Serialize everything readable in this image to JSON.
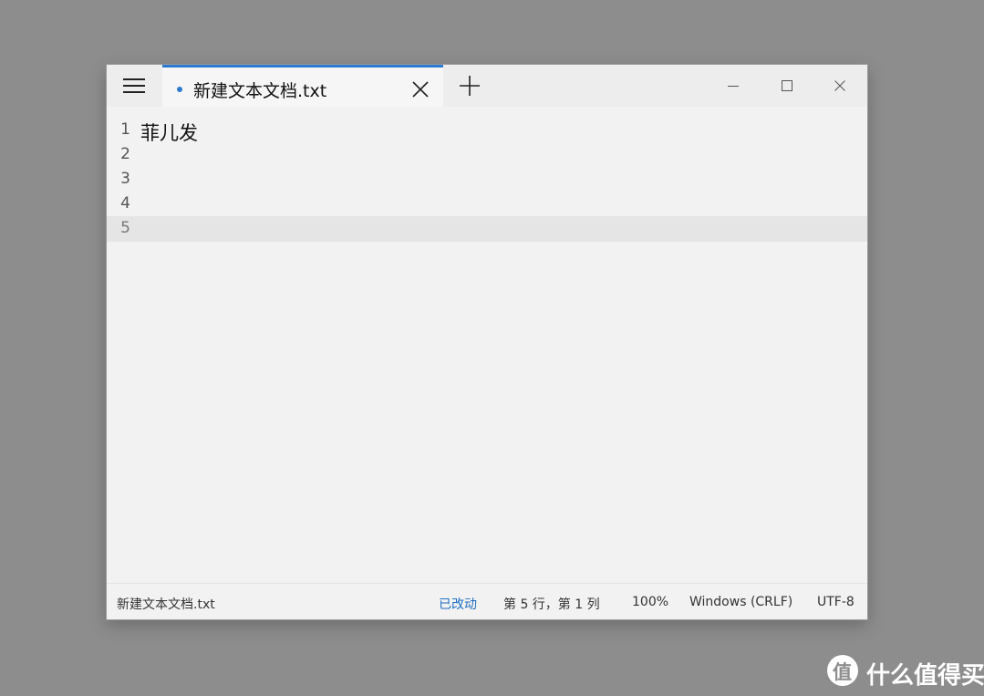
{
  "app": {
    "tab_title": "新建文本文档.txt"
  },
  "editor": {
    "lines": [
      {
        "number": "1",
        "text": "菲儿发"
      },
      {
        "number": "2",
        "text": ""
      },
      {
        "number": "3",
        "text": ""
      },
      {
        "number": "4",
        "text": ""
      },
      {
        "number": "5",
        "text": ""
      }
    ]
  },
  "status": {
    "filename": "新建文本文档.txt",
    "modified": "已改动",
    "position": "第 5 行，第 1 列",
    "zoom": "100%",
    "line_ending": "Windows (CRLF)",
    "encoding": "UTF-8"
  },
  "watermark": {
    "logo_text": "值",
    "text": "什么值得买"
  },
  "icons": {
    "menu": "hamburger-icon",
    "tab_dot": "unsaved-dot-icon",
    "tab_close": "close-icon",
    "new_tab": "plus-icon",
    "minimize": "minimize-icon",
    "maximize": "maximize-icon",
    "close": "close-icon"
  },
  "colors": {
    "accent": "#2b7ad0",
    "background": "#8e8d8e",
    "editor_bg": "#f3f2f3",
    "current_line": "#e6e5e6"
  }
}
